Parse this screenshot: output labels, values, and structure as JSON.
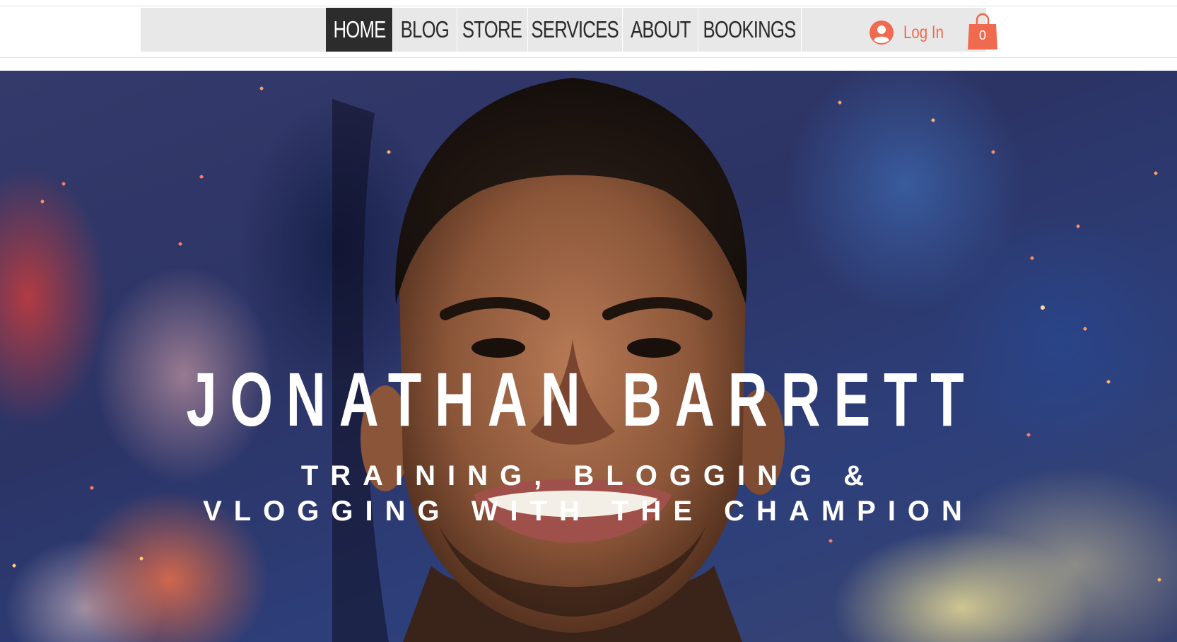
{
  "nav": {
    "items": [
      {
        "label": "HOME",
        "active": true
      },
      {
        "label": "BLOG",
        "active": false
      },
      {
        "label": "STORE",
        "active": false
      },
      {
        "label": "SERVICES",
        "active": false
      },
      {
        "label": "ABOUT",
        "active": false
      },
      {
        "label": "BOOKINGS",
        "active": false
      }
    ]
  },
  "account": {
    "login_label": "Log In",
    "icon": "user-avatar-icon"
  },
  "cart": {
    "count": "0",
    "icon": "shopping-bag-icon"
  },
  "hero": {
    "title": "JONATHAN BARRETT",
    "subtitle": "TRAINING, BLOGGING & VLOGGING WITH THE CHAMPION"
  },
  "colors": {
    "accent": "#ef6a4e",
    "nav_active_bg": "#2c2c2c",
    "nav_bg": "#e8e8e8",
    "hero_text": "#ffffff"
  }
}
